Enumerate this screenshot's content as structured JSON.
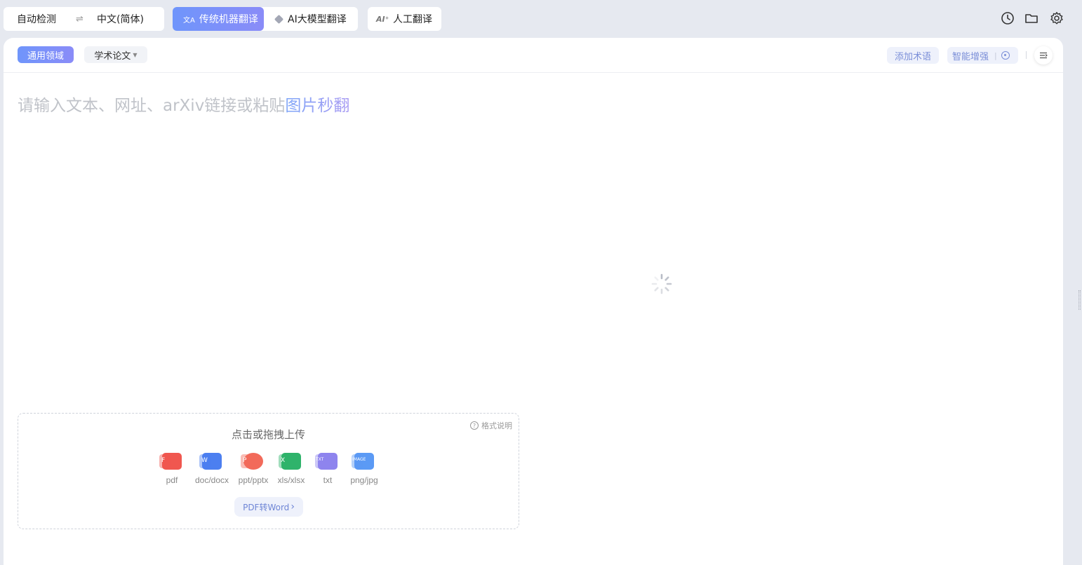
{
  "language_bar": {
    "source_language": "自动检测",
    "swap_symbol": "⇌",
    "target_language": "中文(简体)"
  },
  "translation_modes": {
    "machine": {
      "label": "传统机器翻译",
      "active": true
    },
    "ai_model": {
      "label": "AI大模型翻译",
      "active": false
    },
    "human": {
      "label": "人工翻译",
      "icon_text": "AI⁺"
    }
  },
  "toolbar_icons": [
    "history-clock-icon",
    "folder-icon",
    "settings-gear-icon"
  ],
  "domains": {
    "general": {
      "label": "通用领域",
      "active": true
    },
    "academic": {
      "label": "学术论文",
      "dropdown": true
    }
  },
  "actions": {
    "add_terms": "添加术语",
    "smart_enhance": "智能增强"
  },
  "input": {
    "placeholder_main": "请输入文本、网址、arXiv链接或粘贴",
    "placeholder_highlight": "图片秒翻"
  },
  "upload": {
    "title": "点击或拖拽上传",
    "format_help": "格式说明",
    "file_types": [
      {
        "name": "pdf",
        "letter": "F",
        "color": "#f0574f"
      },
      {
        "name": "doc/docx",
        "letter": "W",
        "color": "#4c7ff0"
      },
      {
        "name": "ppt/pptx",
        "letter": "P",
        "color": "#f26a5a"
      },
      {
        "name": "xls/xlsx",
        "letter": "X",
        "color": "#2fb36b"
      },
      {
        "name": "txt",
        "letter": "TXT",
        "color": "#8e84ee"
      },
      {
        "name": "png/jpg",
        "letter": "IMAGE",
        "color": "#5b9af5"
      }
    ],
    "convert_button": "PDF转Word",
    "convert_chevron": "›"
  },
  "colors": {
    "accent_start": "#6f95fb",
    "accent_end": "#8a8cf8",
    "background": "#e6e9f0",
    "panel": "#ffffff"
  }
}
